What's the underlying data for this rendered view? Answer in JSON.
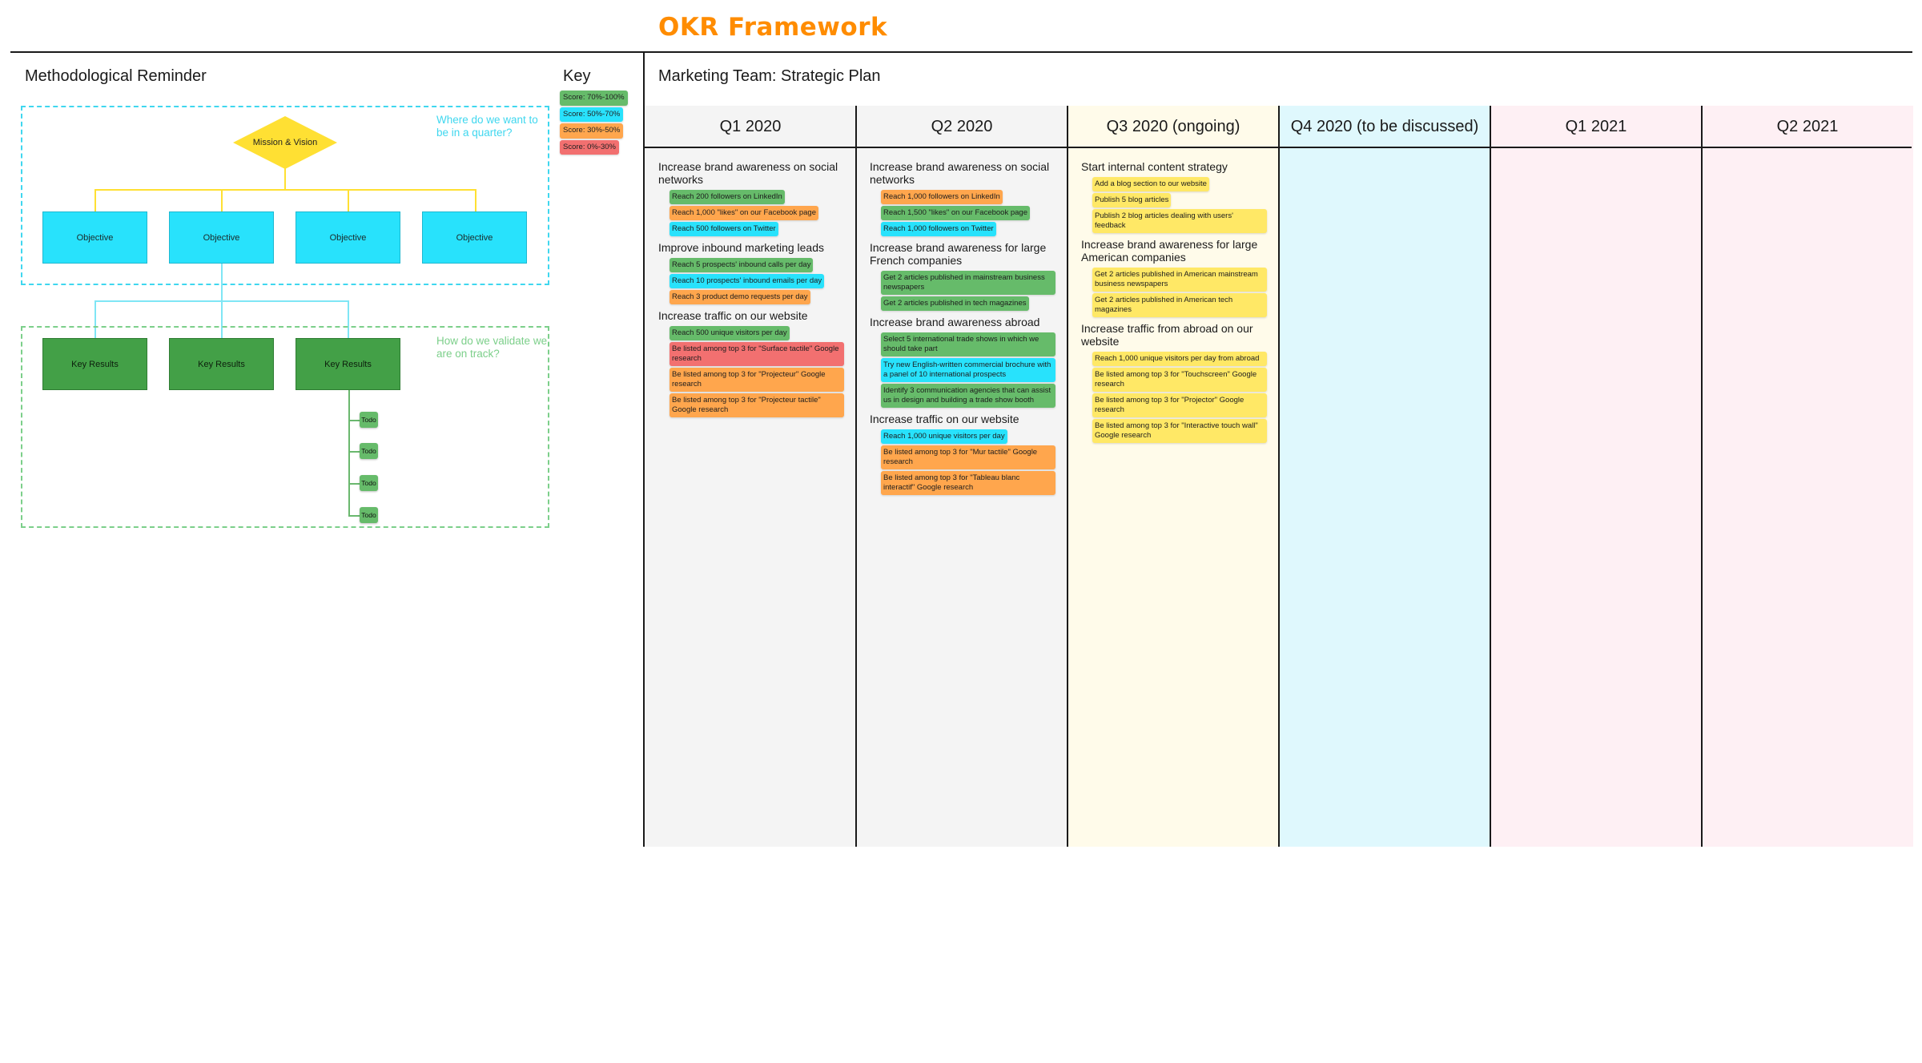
{
  "title": "OKR Framework",
  "colors": {
    "title": "#ff8c00",
    "green": "#66bb6a",
    "cyan": "#28e2fc",
    "orange": "#ffa64d",
    "red": "#f27070",
    "yellow": "#ffe866"
  },
  "methodology": {
    "heading": "Methodological Reminder",
    "mission_label": "Mission & Vision",
    "objective_label": "Objective",
    "objectives_count": 4,
    "key_results_label": "Key Results",
    "todo_label": "Todo",
    "objectives_note": "Where do we want to be in a quarter?",
    "key_results_note": "How do we validate we are on track?"
  },
  "key": {
    "heading": "Key",
    "items": [
      {
        "label": "Score: 70%-100%",
        "color": "green"
      },
      {
        "label": "Score: 50%-70%",
        "color": "cyan"
      },
      {
        "label": "Score: 30%-50%",
        "color": "orange"
      },
      {
        "label": "Score: 0%-30%",
        "color": "red"
      }
    ]
  },
  "plan": {
    "heading": "Marketing Team: Strategic Plan",
    "columns": [
      {
        "label": "Q1 2020",
        "bg": "#f4f4f4",
        "objectives": [
          {
            "title": "Increase brand awareness on social networks",
            "key_results": [
              {
                "text": "Reach 200 followers on LinkedIn",
                "color": "green"
              },
              {
                "text": "Reach 1,000 \"likes\" on our Facebook page",
                "color": "orange"
              },
              {
                "text": "Reach 500 followers on Twitter",
                "color": "cyan"
              }
            ]
          },
          {
            "title": "Improve inbound marketing leads",
            "key_results": [
              {
                "text": "Reach 5 prospects' inbound calls per day",
                "color": "green"
              },
              {
                "text": "Reach 10 prospects' inbound emails per day",
                "color": "cyan"
              },
              {
                "text": "Reach 3 product demo requests per day",
                "color": "orange"
              }
            ]
          },
          {
            "title": "Increase traffic on our website",
            "key_results": [
              {
                "text": "Reach 500 unique visitors per day",
                "color": "green"
              },
              {
                "text": "Be listed among top 3 for \"Surface tactile\" Google research",
                "color": "red"
              },
              {
                "text": "Be listed among top 3 for \"Projecteur\" Google research",
                "color": "orange"
              },
              {
                "text": "Be listed among top 3 for \"Projecteur tactile\" Google research",
                "color": "orange"
              }
            ]
          }
        ]
      },
      {
        "label": "Q2 2020",
        "bg": "#f4f4f4",
        "objectives": [
          {
            "title": "Increase brand awareness on social networks",
            "key_results": [
              {
                "text": "Reach 1,000 followers on LinkedIn",
                "color": "orange"
              },
              {
                "text": "Reach 1,500 \"likes\" on our Facebook page",
                "color": "green"
              },
              {
                "text": "Reach 1,000 followers on Twitter",
                "color": "cyan"
              }
            ]
          },
          {
            "title": "Increase brand awareness for large French companies",
            "key_results": [
              {
                "text": "Get 2 articles published in mainstream business newspapers",
                "color": "green"
              },
              {
                "text": "Get 2 articles published in tech magazines",
                "color": "green"
              }
            ]
          },
          {
            "title": "Increase brand awareness abroad",
            "key_results": [
              {
                "text": "Select 5 international trade shows in which we should take part",
                "color": "green"
              },
              {
                "text": "Try new English-written commercial brochure with a panel of 10 international prospects",
                "color": "cyan"
              },
              {
                "text": "Identify 3 communication agencies that can assist us in design and building a trade show booth",
                "color": "green"
              }
            ]
          },
          {
            "title": "Increase traffic on our website",
            "key_results": [
              {
                "text": "Reach 1,000 unique visitors per day",
                "color": "cyan"
              },
              {
                "text": "Be listed among top 3 for \"Mur tactile\" Google research",
                "color": "orange"
              },
              {
                "text": "Be listed among top 3 for \"Tableau blanc interactif\" Google research",
                "color": "orange"
              }
            ]
          }
        ]
      },
      {
        "label": "Q3 2020 (ongoing)",
        "bg": "#fffbea",
        "objectives": [
          {
            "title": "Start internal content strategy",
            "key_results": [
              {
                "text": "Add a blog section to our website",
                "color": "yellow"
              },
              {
                "text": "Publish 5 blog articles",
                "color": "yellow"
              },
              {
                "text": "Publish 2 blog articles dealing with users' feedback",
                "color": "yellow"
              }
            ]
          },
          {
            "title": "Increase brand awareness for large American companies",
            "key_results": [
              {
                "text": "Get 2 articles published in American mainstream business newspapers",
                "color": "yellow"
              },
              {
                "text": "Get 2 articles published in American tech magazines",
                "color": "yellow"
              }
            ]
          },
          {
            "title": "Increase traffic from abroad on our website",
            "key_results": [
              {
                "text": "Reach 1,000 unique visitors per day from abroad",
                "color": "yellow"
              },
              {
                "text": "Be listed among top 3 for \"Touchscreen\" Google research",
                "color": "yellow"
              },
              {
                "text": "Be listed among top 3 for \"Projector\" Google research",
                "color": "yellow"
              },
              {
                "text": "Be listed among top 3 for \"Interactive touch wall\" Google research",
                "color": "yellow"
              }
            ]
          }
        ]
      },
      {
        "label": "Q4 2020 (to be discussed)",
        "bg": "#dff8fd",
        "objectives": []
      },
      {
        "label": "Q1 2021",
        "bg": "#fef0f4",
        "objectives": []
      },
      {
        "label": "Q2 2021",
        "bg": "#fef0f4",
        "objectives": []
      }
    ]
  }
}
